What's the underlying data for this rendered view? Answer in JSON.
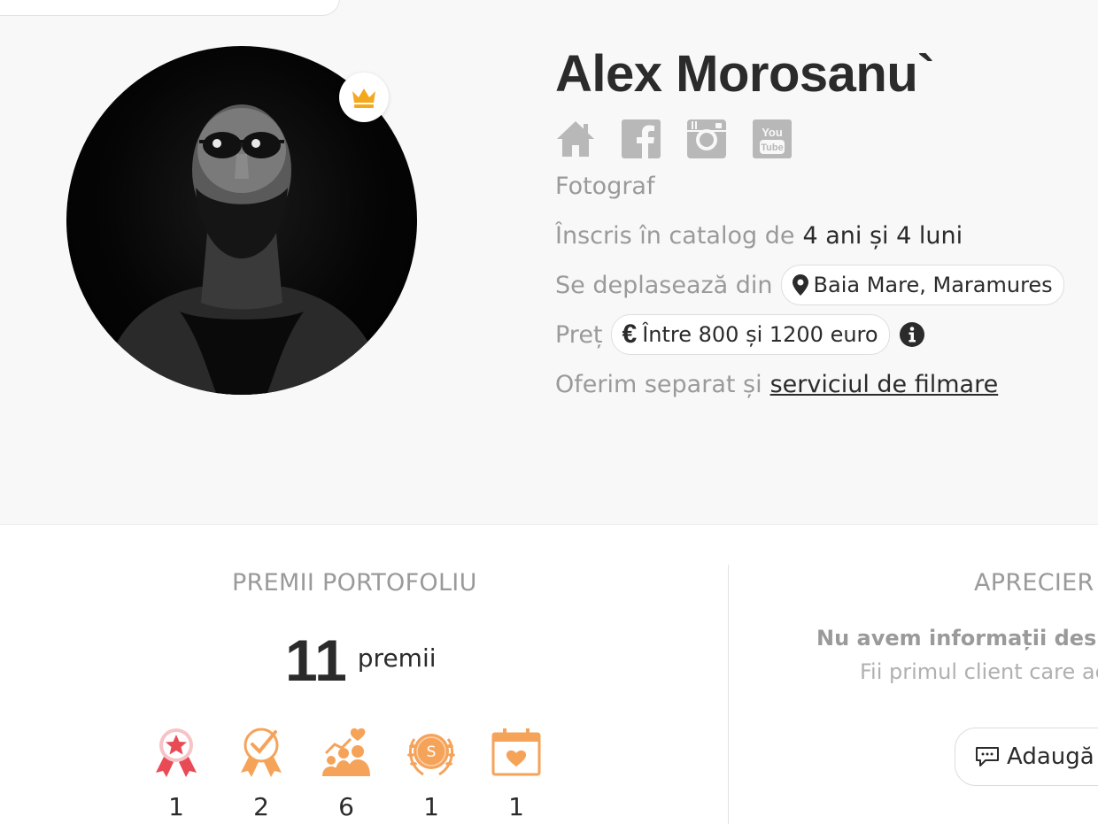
{
  "profile": {
    "name": "Alex Morosanu`",
    "profession": "Fotograf",
    "member_label": "Înscris în catalog de",
    "member_value": "4 ani și 4 luni",
    "travel_label": "Se deplasează din",
    "location": "Baia Mare, Maramures",
    "price_label": "Preț",
    "price_currency_symbol": "€",
    "price_value": "Între 800 și 1200 euro",
    "extra_label": "Oferim separat și",
    "extra_link": "serviciul de filmare",
    "socials": [
      {
        "icon": "home-icon"
      },
      {
        "icon": "facebook-icon"
      },
      {
        "icon": "instagram-icon"
      },
      {
        "icon": "youtube-icon"
      }
    ],
    "colors": {
      "icon_gray": "#b8b8b8",
      "crown": "#f4a81d",
      "award_orange": "#f6a35a",
      "award_red": "#e84b55"
    }
  },
  "awards": {
    "title": "PREMII PORTOFOLIU",
    "total": "11",
    "total_label": "premii",
    "badges": [
      {
        "icon": "medal-star-icon",
        "count": "1"
      },
      {
        "icon": "medal-check-icon",
        "count": "2"
      },
      {
        "icon": "people-heart-icon",
        "count": "6"
      },
      {
        "icon": "laurel-coin-icon",
        "count": "1"
      },
      {
        "icon": "calendar-heart-icon",
        "count": "1"
      }
    ]
  },
  "reviews": {
    "title": "APRECIER",
    "empty_strong": "Nu avem informații desp",
    "empty_sub": "Fii primul client care ac",
    "add_button": "Adaugă t"
  }
}
